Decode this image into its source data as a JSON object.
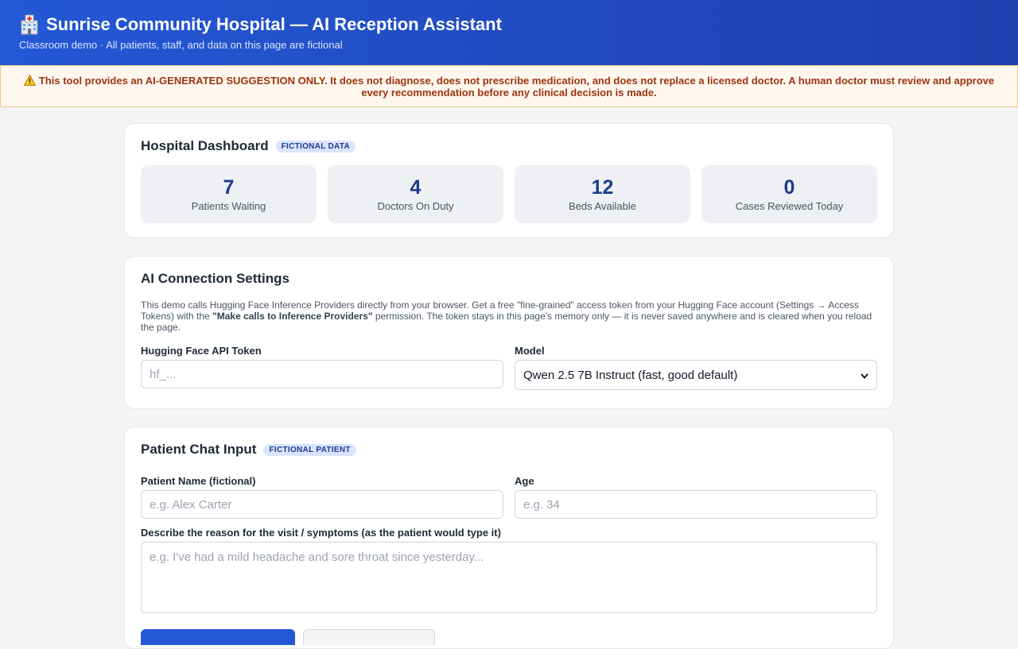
{
  "header": {
    "title": "Sunrise Community Hospital — AI Reception Assistant",
    "subtitle": "Classroom demo · All patients, staff, and data on this page are fictional",
    "icon": "hospital-icon"
  },
  "warning": {
    "icon": "warning-icon",
    "text": "This tool provides an AI-GENERATED SUGGESTION ONLY. It does not diagnose, does not prescribe medication, and does not replace a licensed doctor. A human doctor must review and approve every recommendation before any clinical decision is made."
  },
  "dashboard": {
    "title": "Hospital Dashboard",
    "badge": "FICTIONAL DATA",
    "stats": [
      {
        "value": "7",
        "label": "Patients Waiting"
      },
      {
        "value": "4",
        "label": "Doctors On Duty"
      },
      {
        "value": "12",
        "label": "Beds Available"
      },
      {
        "value": "0",
        "label": "Cases Reviewed Today"
      }
    ]
  },
  "settings": {
    "title": "AI Connection Settings",
    "desc_1": "This demo calls Hugging Face Inference Providers directly from your browser. Get a free \"fine-grained\" access token from your Hugging Face account (Settings → Access Tokens) with the ",
    "desc_bold": "\"Make calls to Inference Providers\"",
    "desc_2": " permission. The token stays in this page's memory only — it is never saved anywhere and is cleared when you reload the page.",
    "token_label": "Hugging Face API Token",
    "token_placeholder": "hf_...",
    "model_label": "Model",
    "model_selected": "Qwen 2.5 7B Instruct (fast, good default)"
  },
  "patient": {
    "title": "Patient Chat Input",
    "badge": "FICTIONAL PATIENT",
    "name_label": "Patient Name (fictional)",
    "name_placeholder": "e.g. Alex Carter",
    "age_label": "Age",
    "age_placeholder": "e.g. 34",
    "symptoms_label": "Describe the reason for the visit / symptoms (as the patient would type it)",
    "symptoms_placeholder": "e.g. I've had a mild headache and sore throat since yesterday..."
  },
  "colors": {
    "header_gradient_start": "#2458d6",
    "header_gradient_end": "#1e40af",
    "accent": "#1e3a8a",
    "warning_text": "#9a3412",
    "warning_bg": "#fff7ed"
  }
}
